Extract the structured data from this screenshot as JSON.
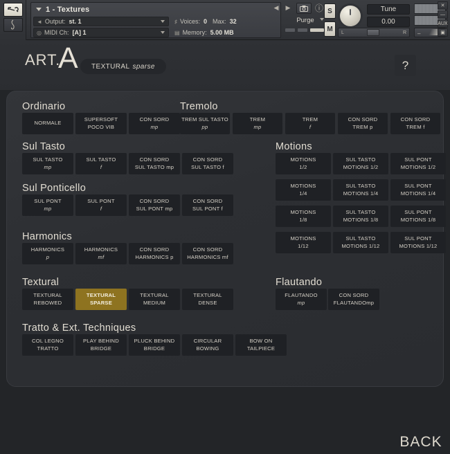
{
  "host": {
    "rail": {
      "wrench_icon": "wrench-icon",
      "clef_icon": "treble-clef-icon"
    },
    "instrument": {
      "name": "1 - Textures",
      "output_label": "Output:",
      "output_value": "st. 1",
      "midi_label": "MIDI Ch:",
      "midi_value": "[A] 1",
      "voices_label": "Voices:",
      "voices_value": "0",
      "max_label": "Max:",
      "max_value": "32",
      "memory_label": "Memory:",
      "memory_value": "5.00 MB"
    },
    "purge_label": "Purge",
    "solo_label": "S",
    "mute_label": "M",
    "tune_label": "Tune",
    "tune_value": "0.00",
    "pan_left": "L",
    "pan_right": "R",
    "vol_minus": "–",
    "vol_plus": "+",
    "prev_arrow": "◀",
    "next_arrow": "▶",
    "camera_icon": "camera-icon",
    "info_icon": "info-icon",
    "window_buttons": [
      "✕",
      "—",
      "AUX",
      "▣"
    ]
  },
  "art_header": {
    "label": "ART.",
    "big_letter": "A",
    "pill_main": "TEXTURAL",
    "pill_italic": "sparse",
    "help_label": "?"
  },
  "panel": {
    "back_label": "BACK",
    "accent_color": "#8e7320",
    "sections": [
      {
        "name": "ordinario",
        "title": "Ordinario",
        "buttons": [
          {
            "line1": "NORMALE",
            "line2": "",
            "active": false
          },
          {
            "line1": "SUPERSOFT",
            "line2": "POCO VIB",
            "active": false
          },
          {
            "line1": "CON SORD",
            "line2": "mp",
            "dyn": true,
            "active": false
          }
        ]
      },
      {
        "name": "tremolo",
        "title": "Tremolo",
        "buttons": [
          {
            "line1": "TREM SUL TASTO",
            "line2": "pp",
            "dyn": true,
            "active": false
          },
          {
            "line1": "TREM",
            "line2": "mp",
            "dyn": true,
            "active": false
          },
          {
            "line1": "TREM",
            "line2": "f",
            "dyn": true,
            "active": false
          },
          {
            "line1": "CON SORD",
            "line2": "TREM p",
            "active": false
          },
          {
            "line1": "CON SORD",
            "line2": "TREM f",
            "active": false
          }
        ]
      },
      {
        "name": "sul-tasto",
        "title": "Sul Tasto",
        "buttons": [
          {
            "line1": "SUL TASTO",
            "line2": "mp",
            "dyn": true,
            "active": false
          },
          {
            "line1": "SUL TASTO",
            "line2": "f",
            "dyn": true,
            "active": false
          },
          {
            "line1": "CON SORD",
            "line2": "SUL TASTO mp",
            "active": false
          },
          {
            "line1": "CON SORD",
            "line2": "SUL TASTO f",
            "active": false
          }
        ]
      },
      {
        "name": "sul-ponticello",
        "title": "Sul Ponticello",
        "buttons": [
          {
            "line1": "SUL PONT",
            "line2": "mp",
            "dyn": true,
            "active": false
          },
          {
            "line1": "SUL PONT",
            "line2": "f",
            "dyn": true,
            "active": false
          },
          {
            "line1": "CON SORD",
            "line2": "SUL PONT mp",
            "active": false
          },
          {
            "line1": "CON SORD",
            "line2": "SUL PONT f",
            "active": false
          }
        ]
      },
      {
        "name": "harmonics",
        "title": "Harmonics",
        "buttons": [
          {
            "line1": "HARMONICS",
            "line2": "p",
            "dyn": true,
            "active": false
          },
          {
            "line1": "HARMONICS",
            "line2": "mf",
            "dyn": true,
            "active": false
          },
          {
            "line1": "CON SORD",
            "line2": "HARMONICS p",
            "active": false
          },
          {
            "line1": "CON SORD",
            "line2": "HARMONICS mf",
            "active": false
          }
        ]
      },
      {
        "name": "textural",
        "title": "Textural",
        "buttons": [
          {
            "line1": "TEXTURAL",
            "line2": "REBOWED",
            "active": false
          },
          {
            "line1": "TEXTURAL",
            "line2": "SPARSE",
            "active": true
          },
          {
            "line1": "TEXTURAL",
            "line2": "MEDIUM",
            "active": false
          },
          {
            "line1": "TEXTURAL",
            "line2": "DENSE",
            "active": false
          }
        ]
      },
      {
        "name": "tratto-ext-techniques",
        "title": "Tratto & Ext. Techniques",
        "buttons": [
          {
            "line1": "COL LEGNO",
            "line2": "TRATTO",
            "active": false
          },
          {
            "line1": "PLAY BEHIND",
            "line2": "BRIDGE",
            "active": false
          },
          {
            "line1": "PLUCK BEHIND",
            "line2": "BRIDGE",
            "active": false
          },
          {
            "line1": "CIRCULAR",
            "line2": "BOWING",
            "active": false
          },
          {
            "line1": "BOW ON",
            "line2": "TAILPIECE",
            "active": false
          }
        ]
      },
      {
        "name": "motions",
        "title": "Motions",
        "buttons": [
          {
            "line1": "MOTIONS",
            "line2": "1/2",
            "active": false
          },
          {
            "line1": "SUL TASTO",
            "line2": "MOTIONS 1/2",
            "active": false
          },
          {
            "line1": "SUL PONT",
            "line2": "MOTIONS 1/2",
            "active": false
          },
          {
            "line1": "MOTIONS",
            "line2": "1/4",
            "active": false
          },
          {
            "line1": "SUL TASTO",
            "line2": "MOTIONS 1/4",
            "active": false
          },
          {
            "line1": "SUL PONT",
            "line2": "MOTIONS 1/4",
            "active": false
          },
          {
            "line1": "MOTIONS",
            "line2": "1/8",
            "active": false
          },
          {
            "line1": "SUL TASTO",
            "line2": "MOTIONS 1/8",
            "active": false
          },
          {
            "line1": "SUL PONT",
            "line2": "MOTIONS 1/8",
            "active": false
          },
          {
            "line1": "MOTIONS",
            "line2": "1/12",
            "active": false
          },
          {
            "line1": "SUL TASTO",
            "line2": "MOTIONS 1/12",
            "active": false
          },
          {
            "line1": "SUL PONT",
            "line2": "MOTIONS 1/12",
            "active": false
          }
        ]
      },
      {
        "name": "flautando",
        "title": "Flautando",
        "buttons": [
          {
            "line1": "FLAUTANDO",
            "line2": "mp",
            "dyn": true,
            "active": false
          },
          {
            "line1": "CON SORD",
            "line2": "FLAUTANDOmp",
            "active": false
          }
        ]
      }
    ]
  }
}
